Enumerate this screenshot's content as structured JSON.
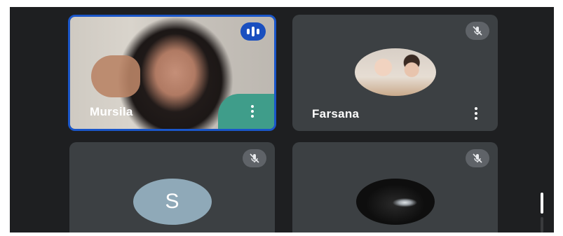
{
  "participants": [
    {
      "name": "Mursila",
      "mic": "speaking",
      "type": "video",
      "icon": "speaking-indicator-icon",
      "menu_icon": "more-vert-icon"
    },
    {
      "name": "Farsana",
      "mic": "muted",
      "type": "photo-avatar",
      "icon": "mic-off-icon",
      "menu_icon": "more-vert-icon"
    },
    {
      "name": "",
      "mic": "muted",
      "type": "letter-avatar",
      "avatar_letter": "S",
      "icon": "mic-off-icon"
    },
    {
      "name": "",
      "mic": "muted",
      "type": "photo-avatar",
      "icon": "mic-off-icon"
    }
  ],
  "colors": {
    "stage_bg": "#1e1f21",
    "tile_bg": "#3c4043",
    "active_speaker_border": "#1a56c9",
    "speaking_badge": "#1a4fbf",
    "mic_badge": "#5f6368",
    "letter_avatar_bg": "#8fa9b8"
  }
}
